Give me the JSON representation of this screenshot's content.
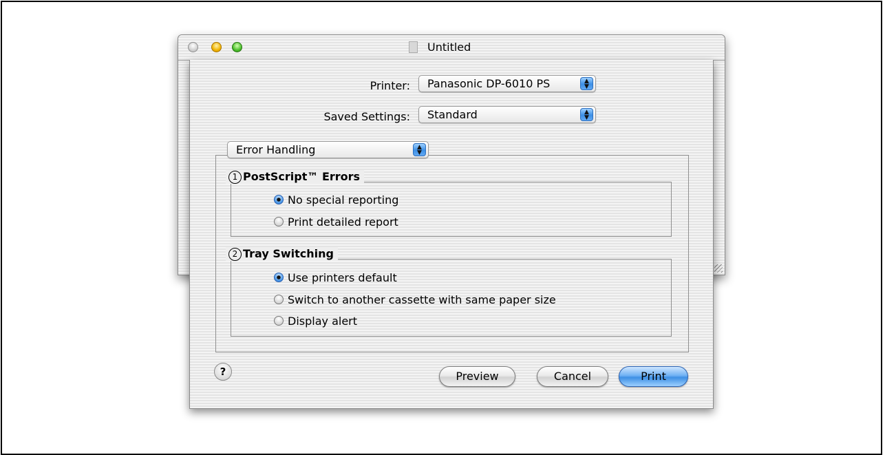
{
  "window": {
    "title": "Untitled"
  },
  "print_dialog": {
    "printer_label": "Printer:",
    "printer_value": "Panasonic DP-6010 PS",
    "saved_settings_label": "Saved Settings:",
    "saved_settings_value": "Standard",
    "panel_value": "Error Handling",
    "groups": [
      {
        "number": "1",
        "title": "PostScript™ Errors",
        "options": [
          {
            "label": "No special reporting",
            "selected": true
          },
          {
            "label": "Print detailed report",
            "selected": false
          }
        ]
      },
      {
        "number": "2",
        "title": "Tray Switching",
        "options": [
          {
            "label": "Use printers default",
            "selected": true
          },
          {
            "label": "Switch to another cassette with same paper size",
            "selected": false
          },
          {
            "label": "Display alert",
            "selected": false
          }
        ]
      }
    ],
    "help_label": "?",
    "buttons": {
      "preview": "Preview",
      "cancel": "Cancel",
      "print": "Print"
    }
  },
  "colors": {
    "default_button": "#3e8fe4",
    "popup_arrows": "#3c8fe6"
  }
}
